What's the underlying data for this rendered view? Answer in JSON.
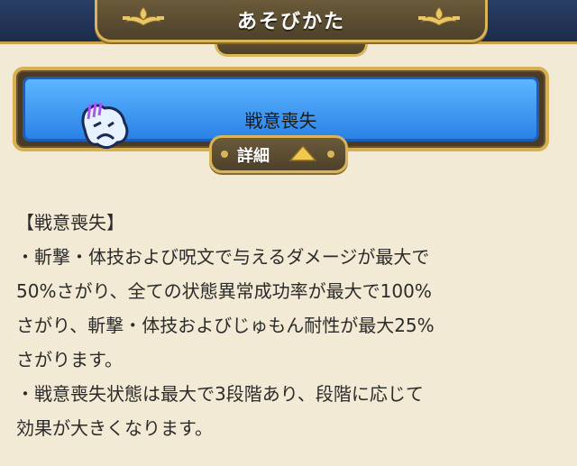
{
  "header": {
    "title": "あそびかた",
    "peek_tab_label": "詳細"
  },
  "card": {
    "title": "戦意喪失",
    "icon": "sad-face-icon"
  },
  "detail_button": {
    "label": "詳細",
    "icon": "triangle-up-icon"
  },
  "description": {
    "lines": [
      "【戦意喪失】",
      "・斬撃・体技および呪文で与えるダメージが最大で",
      "50%さがり、全ての状態異常成功率が最大で100%",
      "さがり、斬撃・体技およびじゅもん耐性が最大25%",
      "さがります。",
      "・戦意喪失状態は最大で3段階あり、段階に応じて",
      "効果が大きくなります。"
    ]
  },
  "colors": {
    "accent_gold": "#d9b55a",
    "card_blue": "#3a95f0",
    "background": "#f3ead6"
  }
}
